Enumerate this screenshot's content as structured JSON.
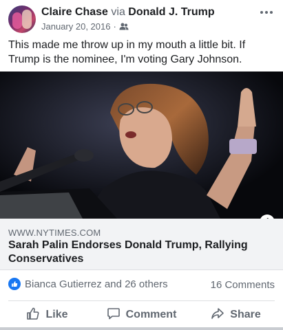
{
  "post": {
    "author": "Claire Chase",
    "via_word": "via",
    "via_page": "Donald J. Trump",
    "date": "January 20, 2016",
    "separator": "·",
    "audience_icon": "friends-icon",
    "more_icon": "more-dots-icon",
    "text": "This made me throw up in my mouth a little bit. If Trump is the nominee, I'm voting Gary Johnson."
  },
  "link": {
    "domain": "WWW.NYTIMES.COM",
    "title": "Sarah Palin Endorses Donald Trump, Rallying Conservatives",
    "info_icon": "info-icon",
    "info_glyph": "i"
  },
  "reactions": {
    "icon": "like-reaction-icon",
    "summary": "Bianca Gutierrez and 26 others",
    "comments": "16 Comments"
  },
  "actions": {
    "like": "Like",
    "comment": "Comment",
    "share": "Share"
  },
  "colors": {
    "facebook_blue": "#1877f2",
    "secondary_text": "#606770",
    "primary_text": "#1c1e21",
    "link_box_bg": "#f2f3f5"
  }
}
